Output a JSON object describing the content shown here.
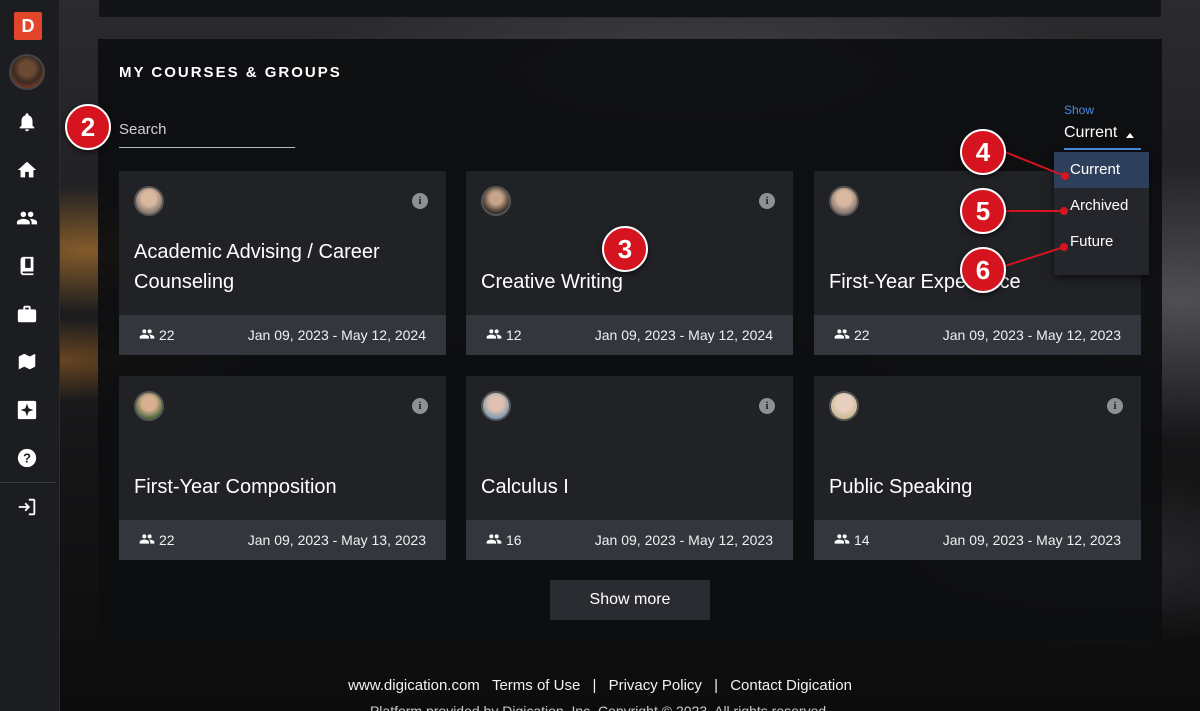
{
  "sidebar": {
    "logo_letter": "D",
    "items": [
      {
        "icon": "bell-icon"
      },
      {
        "icon": "home-icon"
      },
      {
        "icon": "people-icon"
      },
      {
        "icon": "book-icon"
      },
      {
        "icon": "briefcase-icon"
      },
      {
        "icon": "library-icon"
      },
      {
        "icon": "sparkle-icon"
      },
      {
        "icon": "help-icon"
      },
      {
        "icon": "logout-icon"
      }
    ]
  },
  "section": {
    "title": "MY COURSES & GROUPS",
    "search_placeholder": "Search",
    "show_label": "Show",
    "show_value": "Current",
    "options": [
      "Current",
      "Archived",
      "Future"
    ]
  },
  "courses": [
    {
      "title": "Academic Advising / Career Counseling",
      "members": "22",
      "dates": "Jan 09, 2023 - May 12, 2024"
    },
    {
      "title": "Creative Writing",
      "members": "12",
      "dates": "Jan 09, 2023 - May 12, 2024"
    },
    {
      "title": "First-Year Experience",
      "members": "22",
      "dates": "Jan 09, 2023 - May 12, 2023"
    },
    {
      "title": "First-Year Composition",
      "members": "22",
      "dates": "Jan 09, 2023 - May 13, 2023"
    },
    {
      "title": "Calculus I",
      "members": "16",
      "dates": "Jan 09, 2023 - May 12, 2023"
    },
    {
      "title": "Public Speaking",
      "members": "14",
      "dates": "Jan 09, 2023 - May 12, 2023"
    }
  ],
  "show_more_label": "Show more",
  "footer": {
    "site": "www.digication.com",
    "links": [
      "Terms of Use",
      "Privacy Policy",
      "Contact Digication"
    ],
    "separator": "|",
    "copyright": "Platform provided by Digication, Inc. Copyright © 2023. All rights reserved."
  },
  "markers": [
    "2",
    "3",
    "4",
    "5",
    "6"
  ],
  "colors": {
    "accent": "#4a8fe0",
    "marker": "#d6141f",
    "logo": "#e2452a"
  }
}
